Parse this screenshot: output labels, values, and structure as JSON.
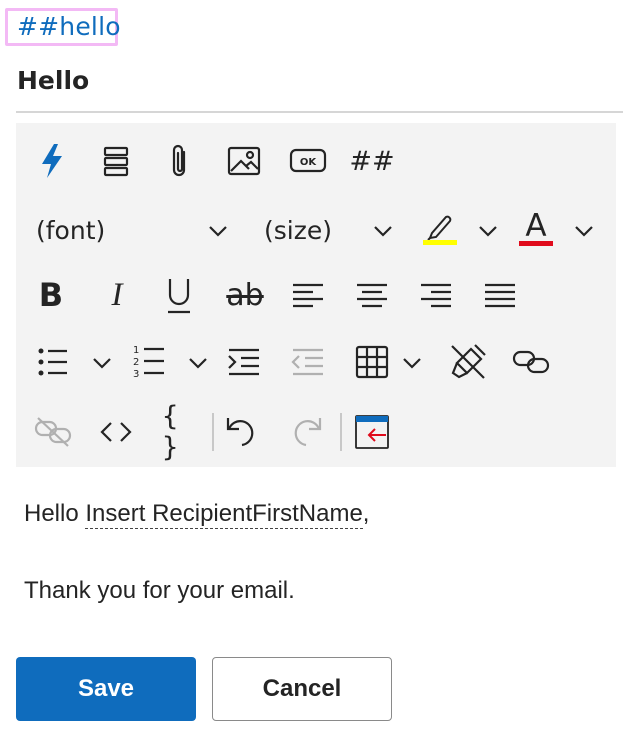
{
  "tag": {
    "label": "##hello"
  },
  "title": "Hello",
  "toolbar": {
    "row1": [
      "lightning-icon",
      "stack-icon",
      "paperclip-icon",
      "image-icon",
      "button-ok-icon",
      "hash-icon"
    ],
    "hash_label": "##",
    "ok_label": "OK",
    "font_dropdown": "(font)",
    "size_dropdown": "(size)",
    "highlight_color": "#ffff00",
    "font_color": "#e00b1c",
    "accent_color": "#0f6cbd",
    "font_color_letter": "A",
    "bold": "B",
    "italic": "I",
    "underline": "U",
    "strike": "ab",
    "code_braces": "{ }"
  },
  "body": {
    "greeting": "Hello",
    "token": "Insert RecipientFirstName",
    "comma": ",",
    "line2": "Thank you for your email."
  },
  "buttons": {
    "save": "Save",
    "cancel": "Cancel"
  }
}
